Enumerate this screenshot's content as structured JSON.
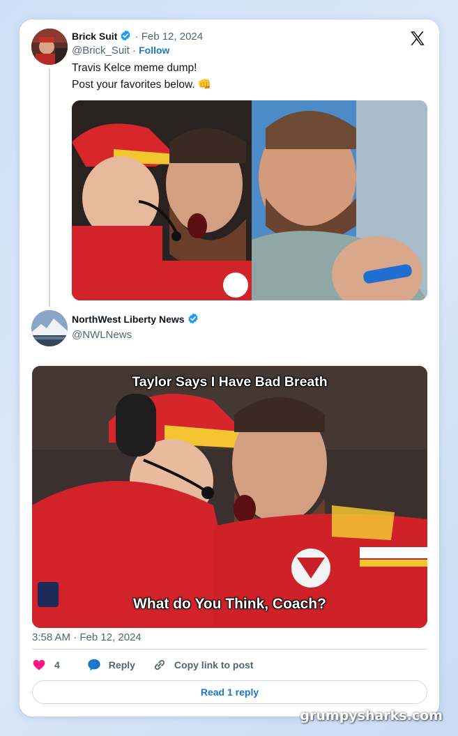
{
  "tweet1": {
    "name": "Brick Suit",
    "date": "· Feb 12, 2024",
    "handle": "@Brick_Suit",
    "dot": "·",
    "follow": "Follow",
    "text_line1": "Travis Kelce meme dump!",
    "text_line2": "Post your favorites below. 👊",
    "avatar_icon": "avatar-photo"
  },
  "tweet2": {
    "name": "NorthWest Liberty News",
    "handle": "@NWLNews",
    "meme_top": "Taylor Says I Have Bad Breath",
    "meme_bottom": "What do You Think, Coach?",
    "timestamp": "3:58 AM · Feb 12, 2024"
  },
  "actions": {
    "like_count": "4",
    "reply_label": "Reply",
    "copy_label": "Copy link to post",
    "read_reply": "Read 1 reply"
  },
  "colors": {
    "accent": "#1d76c9",
    "verified": "#1d9bf0",
    "like": "#f91880",
    "text": "#0f1419",
    "muted": "#536471"
  },
  "icons": {
    "platform": "x-logo-icon",
    "verified": "verified-badge-icon",
    "like": "heart-icon",
    "reply": "reply-bubble-icon",
    "copy": "link-icon"
  },
  "watermark": "grumpysharks.com"
}
